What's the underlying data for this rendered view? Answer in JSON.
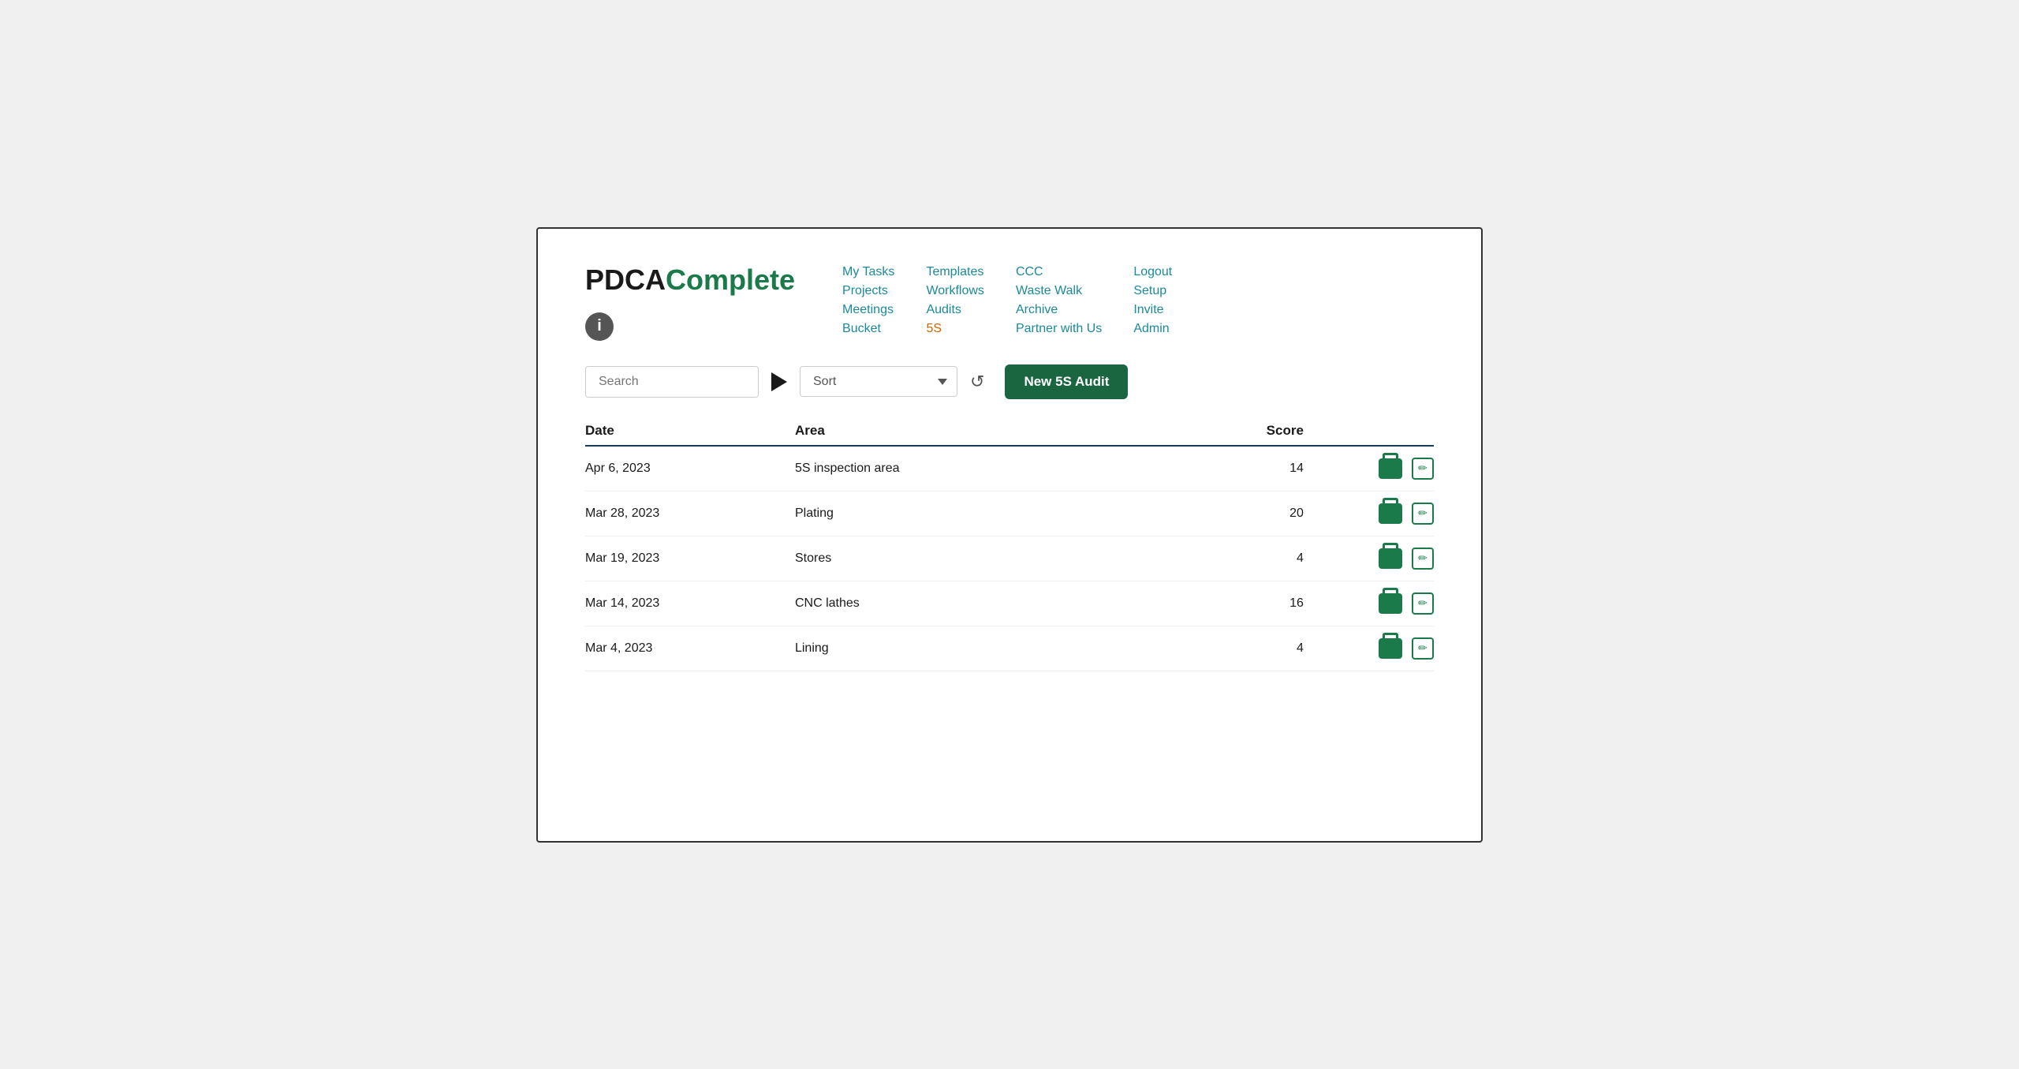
{
  "logo": {
    "prefix": "PDCA",
    "suffix": "Complete"
  },
  "nav": {
    "col1": [
      {
        "label": "My Tasks",
        "color": "teal"
      },
      {
        "label": "Projects",
        "color": "teal"
      },
      {
        "label": "Meetings",
        "color": "teal"
      },
      {
        "label": "Bucket",
        "color": "teal"
      }
    ],
    "col2": [
      {
        "label": "Templates",
        "color": "teal"
      },
      {
        "label": "Workflows",
        "color": "teal"
      },
      {
        "label": "Audits",
        "color": "teal"
      },
      {
        "label": "5S",
        "color": "orange"
      }
    ],
    "col3": [
      {
        "label": "CCC",
        "color": "teal"
      },
      {
        "label": "Waste Walk",
        "color": "teal"
      },
      {
        "label": "Archive",
        "color": "teal"
      },
      {
        "label": "Partner with Us",
        "color": "teal"
      }
    ],
    "col4": [
      {
        "label": "Logout",
        "color": "teal"
      },
      {
        "label": "Setup",
        "color": "teal"
      },
      {
        "label": "Invite",
        "color": "teal"
      },
      {
        "label": "Admin",
        "color": "teal"
      }
    ]
  },
  "toolbar": {
    "search_placeholder": "Search",
    "sort_placeholder": "Sort",
    "new_audit_label": "New 5S Audit"
  },
  "table": {
    "headers": {
      "date": "Date",
      "area": "Area",
      "score": "Score"
    },
    "rows": [
      {
        "date": "Apr 6, 2023",
        "area": "5S inspection area",
        "score": "14"
      },
      {
        "date": "Mar 28, 2023",
        "area": "Plating",
        "score": "20"
      },
      {
        "date": "Mar 19, 2023",
        "area": "Stores",
        "score": "4"
      },
      {
        "date": "Mar 14, 2023",
        "area": "CNC lathes",
        "score": "16"
      },
      {
        "date": "Mar 4, 2023",
        "area": "Lining",
        "score": "4"
      }
    ]
  }
}
